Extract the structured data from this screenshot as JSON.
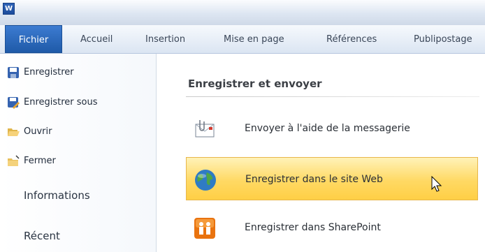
{
  "app": {
    "icon_letter": "W"
  },
  "ribbon": {
    "tabs": [
      "Fichier",
      "Accueil",
      "Insertion",
      "Mise en page",
      "Références",
      "Publipostage"
    ]
  },
  "backstage": {
    "commands": [
      {
        "label": "Enregistrer",
        "icon": "save-icon"
      },
      {
        "label": "Enregistrer sous",
        "icon": "save-as-icon"
      },
      {
        "label": "Ouvrir",
        "icon": "open-folder-icon"
      },
      {
        "label": "Fermer",
        "icon": "close-folder-icon"
      }
    ],
    "nav": [
      "Informations",
      "Récent"
    ]
  },
  "main": {
    "title": "Enregistrer et envoyer",
    "options": [
      {
        "label": "Envoyer à l'aide de la messagerie",
        "icon": "email-attachment-icon",
        "selected": false
      },
      {
        "label": "Enregistrer dans le site Web",
        "icon": "globe-icon",
        "selected": true
      },
      {
        "label": "Enregistrer dans SharePoint",
        "icon": "sharepoint-icon",
        "selected": false
      }
    ]
  },
  "colors": {
    "fichier_tab": "#2a64b4",
    "selected_option": "#ffd964",
    "ribbon": "#dbe5f2"
  }
}
